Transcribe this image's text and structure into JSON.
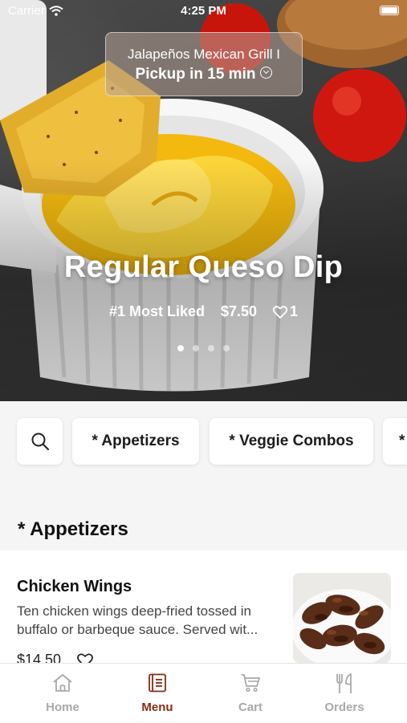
{
  "status_bar": {
    "carrier": "Carrier",
    "time": "4:25 PM"
  },
  "hero": {
    "restaurant": "Jalapeños Mexican Grill I",
    "pickup": "Pickup in 15 min",
    "item_title": "Regular Queso Dip",
    "rank": "#1 Most Liked",
    "price": "$7.50",
    "likes": "1",
    "page_count": 4,
    "active_page": 1
  },
  "categories": {
    "search_icon": "search-icon",
    "chips": [
      "* Appetizers",
      "* Veggie Combos",
      "*"
    ]
  },
  "section": {
    "title": "* Appetizers"
  },
  "menu_items": [
    {
      "name": "Chicken Wings",
      "description": "Ten chicken wings deep-fried tossed in buffalo or barbeque sauce. Served wit...",
      "price": "$14.50",
      "icon": "heart-outline-icon"
    }
  ],
  "tab_bar": {
    "tabs": [
      {
        "label": "Home",
        "icon": "home-icon",
        "active": false
      },
      {
        "label": "Menu",
        "icon": "menu-book-icon",
        "active": true
      },
      {
        "label": "Cart",
        "icon": "cart-icon",
        "active": false
      },
      {
        "label": "Orders",
        "icon": "fork-knife-icon",
        "active": false
      }
    ]
  },
  "colors": {
    "accent": "#8a2a12",
    "inactive_tab": "#a9a9a9",
    "queso": "#f5c21b"
  }
}
